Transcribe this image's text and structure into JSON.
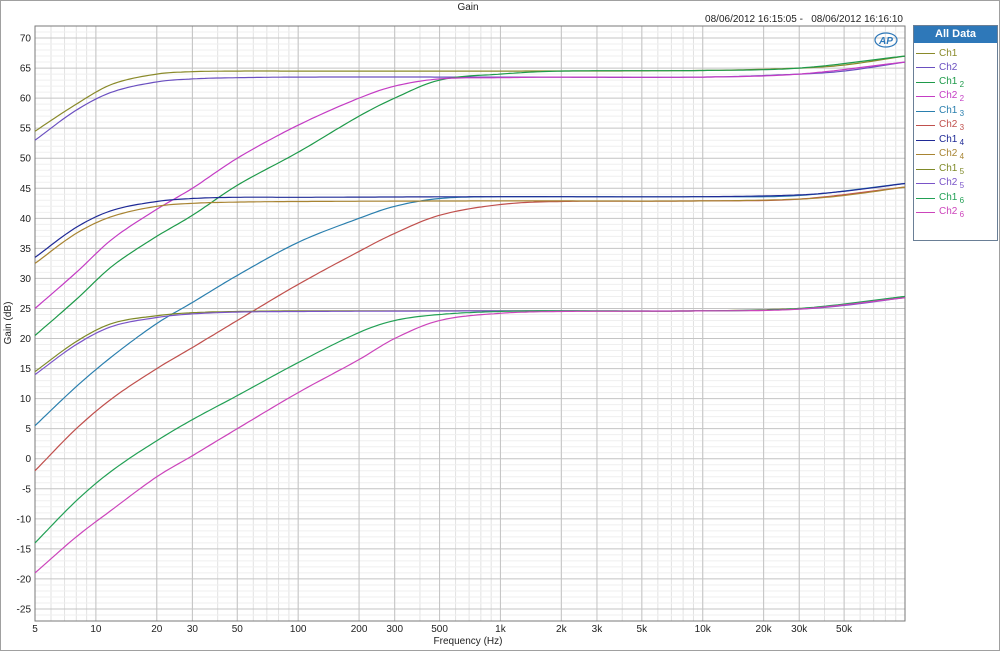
{
  "chart_data": {
    "type": "line",
    "title": "Gain",
    "timestamp": "08/06/2012 16:15:05 -   08/06/2012 16:16:10",
    "xlabel": "Frequency (Hz)",
    "ylabel": "Gain (dB)",
    "x_scale": "log",
    "xlim": [
      5,
      100000
    ],
    "ylim": [
      -27,
      72
    ],
    "grid": true,
    "x_ticks": [
      5,
      10,
      20,
      30,
      50,
      100,
      200,
      300,
      500,
      1000,
      2000,
      3000,
      5000,
      10000,
      20000,
      30000,
      50000
    ],
    "x_tick_labels": [
      "5",
      "10",
      "20",
      "30",
      "50",
      "100",
      "200",
      "300",
      "500",
      "1k",
      "2k",
      "3k",
      "5k",
      "10k",
      "20k",
      "30k",
      "50k"
    ],
    "y_ticks": [
      70,
      65,
      60,
      55,
      50,
      45,
      40,
      35,
      30,
      25,
      20,
      15,
      10,
      5,
      0,
      -5,
      -10,
      -15,
      -20,
      -25
    ],
    "y_tick_labels": [
      "70",
      "65",
      "60",
      "55",
      "50",
      "45",
      "40",
      "35",
      "30",
      "25",
      "20",
      "15",
      "10",
      "5",
      "0",
      "-5",
      "-10",
      "-15",
      "-20",
      "-25"
    ],
    "legend_title": "All Data",
    "legend_position": "right",
    "logo": "AP",
    "series": [
      {
        "name": "Ch1",
        "sub": "",
        "color": "#8a8a2a",
        "x": [
          5,
          8,
          12,
          20,
          30,
          50,
          100,
          1000,
          10000,
          30000,
          50000,
          100000
        ],
        "y": [
          54.5,
          59,
          62.3,
          64,
          64.4,
          64.5,
          64.5,
          64.5,
          64.6,
          65,
          65.5,
          67
        ]
      },
      {
        "name": "Ch2",
        "sub": "",
        "color": "#6a4fc0",
        "x": [
          5,
          8,
          12,
          20,
          30,
          50,
          100,
          1000,
          10000,
          30000,
          50000,
          100000
        ],
        "y": [
          53,
          58,
          61,
          62.7,
          63.2,
          63.4,
          63.5,
          63.5,
          63.5,
          64,
          64.5,
          66
        ]
      },
      {
        "name": "Ch1",
        "sub": "2",
        "color": "#1e9a4a",
        "x": [
          5,
          8,
          12,
          20,
          30,
          50,
          100,
          200,
          300,
          500,
          1000,
          2000,
          10000,
          30000,
          100000
        ],
        "y": [
          20.5,
          26.5,
          32,
          37,
          40.5,
          45.5,
          51,
          57,
          60,
          63,
          64,
          64.5,
          64.6,
          65,
          67
        ]
      },
      {
        "name": "Ch2",
        "sub": "2",
        "color": "#c43cc4",
        "x": [
          5,
          8,
          12,
          20,
          30,
          50,
          100,
          200,
          300,
          500,
          1000,
          2000,
          10000,
          30000,
          100000
        ],
        "y": [
          25,
          31,
          36.5,
          41.5,
          45,
          50,
          55.5,
          60,
          62,
          63.2,
          63.4,
          63.5,
          63.5,
          64,
          66
        ]
      },
      {
        "name": "Ch1",
        "sub": "3",
        "color": "#2a7fae",
        "x": [
          5,
          8,
          12,
          20,
          30,
          50,
          100,
          200,
          300,
          500,
          1000,
          2000,
          10000,
          30000,
          100000
        ],
        "y": [
          5.5,
          12,
          17,
          22.5,
          26,
          30.5,
          36,
          40,
          42,
          43.3,
          43.6,
          43.6,
          43.6,
          43.8,
          45.8
        ]
      },
      {
        "name": "Ch2",
        "sub": "3",
        "color": "#c0504d",
        "x": [
          5,
          8,
          12,
          20,
          30,
          50,
          100,
          200,
          300,
          500,
          1000,
          2000,
          10000,
          30000,
          100000
        ],
        "y": [
          -2,
          5,
          10,
          15,
          18.5,
          23,
          29,
          34.5,
          37.5,
          40.5,
          42.3,
          42.8,
          42.9,
          43.2,
          45.2
        ]
      },
      {
        "name": "Ch1",
        "sub": "4",
        "color": "#1f2a96",
        "x": [
          5,
          8,
          12,
          20,
          30,
          50,
          100,
          1000,
          10000,
          30000,
          50000,
          100000
        ],
        "y": [
          33.5,
          38.5,
          41.3,
          42.8,
          43.3,
          43.5,
          43.5,
          43.6,
          43.6,
          43.9,
          44.5,
          45.8
        ]
      },
      {
        "name": "Ch2",
        "sub": "4",
        "color": "#a88432",
        "x": [
          5,
          8,
          12,
          20,
          30,
          50,
          100,
          1000,
          10000,
          30000,
          50000,
          100000
        ],
        "y": [
          32.5,
          37.5,
          40.3,
          42,
          42.5,
          42.7,
          42.8,
          42.9,
          42.9,
          43.2,
          43.8,
          45.2
        ]
      },
      {
        "name": "Ch1",
        "sub": "5",
        "color": "#7f8a28",
        "x": [
          5,
          8,
          12,
          20,
          30,
          50,
          100,
          1000,
          10000,
          30000,
          50000,
          100000
        ],
        "y": [
          14.5,
          19.5,
          22.5,
          23.8,
          24.3,
          24.5,
          24.6,
          24.6,
          24.6,
          25,
          25.6,
          27
        ]
      },
      {
        "name": "Ch2",
        "sub": "5",
        "color": "#7a54c8",
        "x": [
          5,
          8,
          12,
          20,
          30,
          50,
          100,
          1000,
          10000,
          30000,
          50000,
          100000
        ],
        "y": [
          14,
          19,
          22,
          23.5,
          24.1,
          24.4,
          24.5,
          24.6,
          24.6,
          24.9,
          25.5,
          26.8
        ]
      },
      {
        "name": "Ch1",
        "sub": "6",
        "color": "#22a055",
        "x": [
          5,
          8,
          12,
          20,
          30,
          50,
          100,
          200,
          300,
          500,
          1000,
          2000,
          10000,
          30000,
          100000
        ],
        "y": [
          -14,
          -7,
          -2,
          3,
          6.5,
          10.5,
          16,
          21,
          23,
          24,
          24.5,
          24.6,
          24.6,
          25,
          27
        ]
      },
      {
        "name": "Ch2",
        "sub": "6",
        "color": "#cc44bb",
        "x": [
          5,
          8,
          12,
          20,
          30,
          50,
          100,
          200,
          300,
          500,
          1000,
          2000,
          10000,
          30000,
          100000
        ],
        "y": [
          -19,
          -13,
          -8.5,
          -3,
          0.5,
          5,
          11,
          16.5,
          20,
          23,
          24.2,
          24.5,
          24.6,
          24.9,
          26.8
        ]
      }
    ]
  }
}
